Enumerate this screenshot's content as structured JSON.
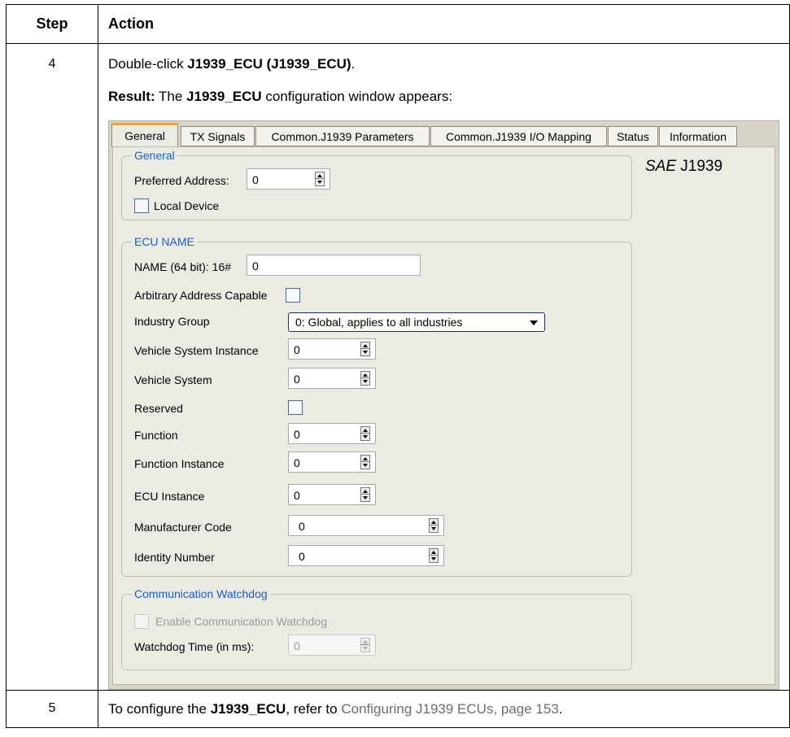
{
  "table": {
    "header_step": "Step",
    "header_action": "Action",
    "rows": [
      {
        "step": "4",
        "line1_pre": "Double-click ",
        "line1_bold": "J1939_ECU (J1939_ECU)",
        "line1_post": ".",
        "line2_bold1": "Result:",
        "line2_mid1": " The ",
        "line2_bold2": "J1939_ECU",
        "line2_post": " configuration window appears:"
      },
      {
        "step": "5",
        "pre": "To configure the ",
        "bold": "J1939_ECU",
        "mid": ", refer to ",
        "link": "Configuring J1939 ECUs, page 153",
        "post": "."
      }
    ]
  },
  "dialog": {
    "tabs": [
      "General",
      "TX Signals",
      "Common.J1939 Parameters",
      "Common.J1939 I/O Mapping",
      "Status",
      "Information"
    ],
    "active_tab": "General",
    "brand_italic": "SAE",
    "brand_rest": " J1939",
    "general": {
      "legend": "General",
      "preferred_address_label": "Preferred Address:",
      "preferred_address_value": "0",
      "local_device_label": "Local Device",
      "local_device_checked": false
    },
    "ecu_name": {
      "legend": "ECU NAME",
      "name_label": "NAME (64 bit): 16#",
      "name_value": "0",
      "arbitrary_label": "Arbitrary Address Capable",
      "arbitrary_checked": false,
      "industry_group_label": "Industry Group",
      "industry_group_value": "0: Global, applies to all industries",
      "vehicle_system_instance_label": "Vehicle System Instance",
      "vehicle_system_instance_value": "0",
      "vehicle_system_label": "Vehicle System",
      "vehicle_system_value": "0",
      "reserved_label": "Reserved",
      "reserved_checked": false,
      "function_label": "Function",
      "function_value": "0",
      "function_instance_label": "Function Instance",
      "function_instance_value": "0",
      "ecu_instance_label": "ECU Instance",
      "ecu_instance_value": "0",
      "manufacturer_code_label": "Manufacturer Code",
      "manufacturer_code_value": "0",
      "identity_number_label": "Identity Number",
      "identity_number_value": "0"
    },
    "watchdog": {
      "legend": "Communication Watchdog",
      "enable_label": "Enable Communication Watchdog",
      "enable_checked": false,
      "time_label": "Watchdog Time (in ms):",
      "time_value": "0"
    }
  },
  "colors": {
    "legend_blue": "#1a5ec7",
    "active_tab_accent": "#f1a23a",
    "panel_bg": "#ecebe3",
    "link_gray": "#6e6e6e"
  }
}
